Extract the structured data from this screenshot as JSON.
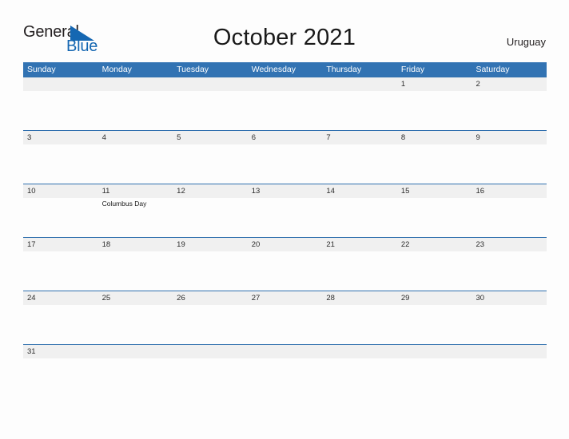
{
  "header": {
    "logo": {
      "word_one": "General",
      "word_two": "Blue",
      "triangle_icon": "triangle-icon"
    },
    "title": "October 2021",
    "country": "Uruguay"
  },
  "calendar": {
    "weekdays": [
      "Sunday",
      "Monday",
      "Tuesday",
      "Wednesday",
      "Thursday",
      "Friday",
      "Saturday"
    ],
    "accent_color": "#3273b3",
    "rule_color": "#2f6fae",
    "strip_color": "#f0f0f0",
    "weeks": [
      {
        "days": [
          {
            "num": "",
            "event": ""
          },
          {
            "num": "",
            "event": ""
          },
          {
            "num": "",
            "event": ""
          },
          {
            "num": "",
            "event": ""
          },
          {
            "num": "",
            "event": ""
          },
          {
            "num": "1",
            "event": ""
          },
          {
            "num": "2",
            "event": ""
          }
        ]
      },
      {
        "days": [
          {
            "num": "3",
            "event": ""
          },
          {
            "num": "4",
            "event": ""
          },
          {
            "num": "5",
            "event": ""
          },
          {
            "num": "6",
            "event": ""
          },
          {
            "num": "7",
            "event": ""
          },
          {
            "num": "8",
            "event": ""
          },
          {
            "num": "9",
            "event": ""
          }
        ]
      },
      {
        "days": [
          {
            "num": "10",
            "event": ""
          },
          {
            "num": "11",
            "event": "Columbus Day"
          },
          {
            "num": "12",
            "event": ""
          },
          {
            "num": "13",
            "event": ""
          },
          {
            "num": "14",
            "event": ""
          },
          {
            "num": "15",
            "event": ""
          },
          {
            "num": "16",
            "event": ""
          }
        ]
      },
      {
        "days": [
          {
            "num": "17",
            "event": ""
          },
          {
            "num": "18",
            "event": ""
          },
          {
            "num": "19",
            "event": ""
          },
          {
            "num": "20",
            "event": ""
          },
          {
            "num": "21",
            "event": ""
          },
          {
            "num": "22",
            "event": ""
          },
          {
            "num": "23",
            "event": ""
          }
        ]
      },
      {
        "days": [
          {
            "num": "24",
            "event": ""
          },
          {
            "num": "25",
            "event": ""
          },
          {
            "num": "26",
            "event": ""
          },
          {
            "num": "27",
            "event": ""
          },
          {
            "num": "28",
            "event": ""
          },
          {
            "num": "29",
            "event": ""
          },
          {
            "num": "30",
            "event": ""
          }
        ]
      },
      {
        "days": [
          {
            "num": "31",
            "event": ""
          },
          {
            "num": "",
            "event": ""
          },
          {
            "num": "",
            "event": ""
          },
          {
            "num": "",
            "event": ""
          },
          {
            "num": "",
            "event": ""
          },
          {
            "num": "",
            "event": ""
          },
          {
            "num": "",
            "event": ""
          }
        ]
      }
    ]
  }
}
